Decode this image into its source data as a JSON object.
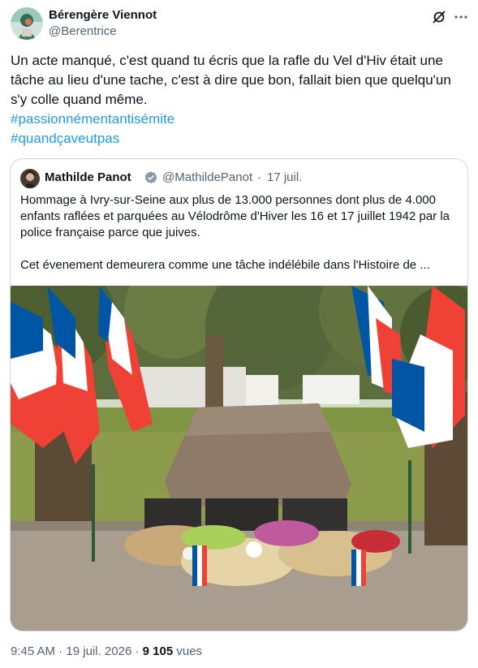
{
  "author": {
    "name": "Bérengère Viennot",
    "handle": "@Berentrice"
  },
  "tweet": {
    "lines": [
      "Un acte manqué, c'est quand tu écris que la rafle du Vel d'Hiv était une",
      "tâche au lieu d'une tache, c'est à dire que bon, fallait bien que quelqu'un",
      "s'y colle quand même."
    ],
    "hashtags": [
      "#passionnémentantisémite",
      "#quandçaveutpas"
    ]
  },
  "quote": {
    "name": "Mathilde Panot",
    "handle": "@MathildePanot",
    "separator": "·",
    "time": "17 juil.",
    "lines": [
      "Hommage à Ivry-sur-Seine aux plus de 13.000 personnes dont plus de 4.000",
      "enfants raflées et parquées au Vélodrôme d'Hiver les 16 et 17 juillet 1942 par la",
      "police française parce que juives.",
      "",
      "Cet évenement demeurera comme une tâche indélébile dans l'Histoire de ..."
    ]
  },
  "footer": {
    "time": "9:45 AM",
    "separator": "·",
    "date": "19 juil. 2026",
    "views_count": "9 105",
    "views_label": "vues"
  },
  "colors": {
    "text": "#0f1419",
    "secondary": "#536471",
    "link": "#1d9bf0",
    "border": "#cfd9de"
  },
  "icons": {
    "grok": "grok-icon",
    "more": "more-icon",
    "verified": "verified-badge-icon"
  }
}
